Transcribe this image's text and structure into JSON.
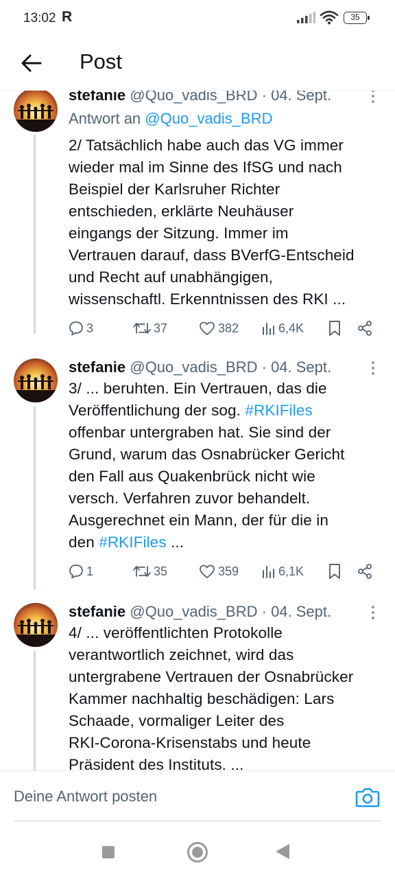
{
  "status_bar": {
    "time": "13:02",
    "r_icon_label": "R",
    "battery": "35",
    "icons": [
      "signal-icon",
      "wifi-icon",
      "battery-icon"
    ]
  },
  "header": {
    "title": "Post",
    "back_icon": "arrow-left-icon"
  },
  "tweets": [
    {
      "name": "stefanie",
      "handle": "@Quo_vadis_BRD",
      "separator": "·",
      "date": "04. Sept.",
      "reply_prefix": "Antwort an",
      "reply_mention": "@Quo_vadis_BRD",
      "lines": [
        "2/ Tatsächlich habe auch das VG immer",
        "wieder mal im Sinne des IfSG und nach",
        "Beispiel der Karlsruher Richter",
        "entschieden, erklärte Neuhäuser",
        "eingangs der Sitzung. Immer im",
        "Vertrauen darauf, dass BVerfG-Entscheid",
        "und Recht auf unabhängigen,",
        "wissenschaftl. Erkenntnissen des RKI ..."
      ],
      "replies": "3",
      "reposts": "37",
      "likes": "382",
      "views": "6,4K"
    },
    {
      "name": "stefanie",
      "handle": "@Quo_vadis_BRD",
      "separator": "·",
      "date": "04. Sept.",
      "line1": "3/ ... beruhten. Ein Vertrauen, das die",
      "line2_pre": "Veröffentlichung der sog. ",
      "line2_tag": "#RKIFiles",
      "line3": "offenbar untergraben hat. Sie sind der",
      "line4": "Grund, warum das Osnabrücker Gericht",
      "line5": "den Fall aus Quakenbrück nicht wie",
      "line6": "versch. Verfahren zuvor behandelt.",
      "line7": "Ausgerechnet ein Mann, der für die in",
      "line8_pre": "den ",
      "line8_tag": "#RKIFiles",
      "line8_post": " ...",
      "replies": "1",
      "reposts": "35",
      "likes": "359",
      "views": "6,1K"
    },
    {
      "name": "stefanie",
      "handle": "@Quo_vadis_BRD",
      "separator": "·",
      "date": "04. Sept.",
      "lines": [
        "4/ ... veröffentlichten Protokolle",
        "verantwortlich zeichnet, wird das",
        "untergrabene Vertrauen der Osnabrücker",
        "Kammer nachhaltig beschädigen: Lars",
        "Schaade, vormaliger Leiter des",
        "RKI-Corona-Krisenstabs und heute",
        "Präsident des Instituts. ..."
      ]
    }
  ],
  "reply_bar": {
    "placeholder": "Deine Antwort posten",
    "camera_icon": "camera-icon"
  },
  "nav_bar": {
    "icons": [
      "recents-square-icon",
      "home-circle-icon",
      "back-triangle-icon"
    ]
  },
  "colors": {
    "accent": "#1d9bf0",
    "secondary_text": "#536471",
    "thread_line": "#cfd9de"
  }
}
